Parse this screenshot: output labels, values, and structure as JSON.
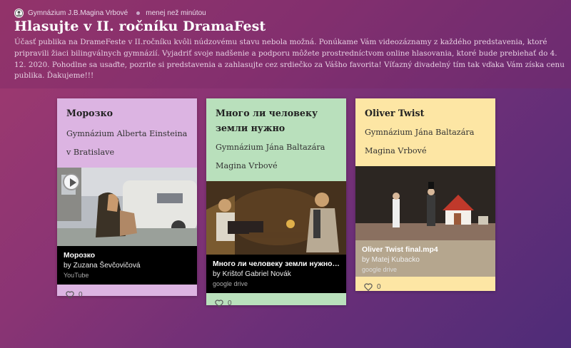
{
  "header": {
    "author": "Gymnázium J.B.Magina Vrbové",
    "time": "menej než minútou",
    "title": "Hlasujte v II. ročníku DramaFest",
    "description": "Účasť publika na DrameFeste v II.ročníku kvôli núdzovému stavu nebola možná. Ponúkame Vám videozáznamy z každého predstavenia, ktoré pripravili žiaci bilingválnych gymnázií. Vyjadriť svoje nadšenie a podporu môžete prostredníctvom online hlasovania, ktoré bude prebiehať do 4. 12. 2020. Pohodlne sa usaďte, pozrite si predstavenia a zahlasujte cez srdiečko za Vášho favorita! Víťazný divadelný tím tak vďaka Vám získa cenu publika. Ďakujeme!!!"
  },
  "cards": [
    {
      "title": "Морозко",
      "subtitle": "Gymnázium Alberta Einsteina v Bratislave",
      "bg": "#dcb4e2",
      "media_title": "Морозко",
      "media_author": "by Zuzana Ševčovičová",
      "media_source": "YouTube",
      "likes": "0"
    },
    {
      "title": "Много ли человеку земли нужно",
      "subtitle": "Gymnázium Jána Baltazára Magina Vrbové",
      "bg": "#b9e0bc",
      "media_title": "Много ли человеку земли нужно.m...",
      "media_author": "by Krištof Gabriel Novák",
      "media_source": "google drive",
      "likes": "0"
    },
    {
      "title": "Oliver Twist",
      "subtitle": "Gymnázium Jána Baltazára Magina Vrbové",
      "bg": "#fde6a4",
      "media_title": "Oliver Twist final.mp4",
      "media_author": "by Matej Kubacko",
      "media_source": "google drive",
      "likes": "0"
    }
  ]
}
